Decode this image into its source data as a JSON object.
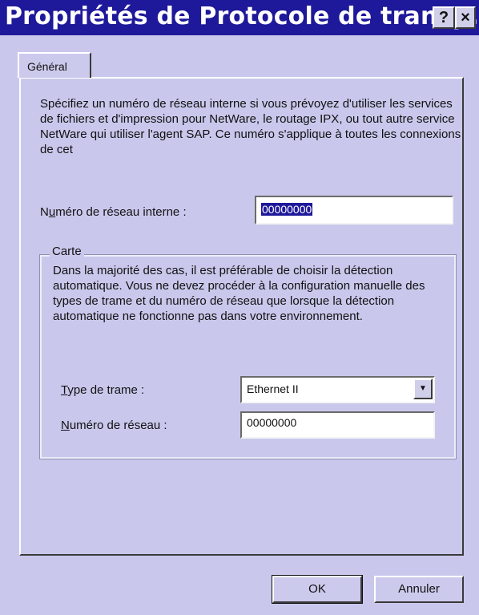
{
  "window": {
    "title": "Propriétés de Protocole de transp...",
    "help_button": "?",
    "close_button": "×"
  },
  "tabs": [
    {
      "label": "Général"
    }
  ],
  "main": {
    "description": "Spécifiez un numéro de réseau interne si vous prévoyez d'utiliser les services de fichiers et d'impression pour NetWare, le routage IPX, ou tout autre service NetWare qui utiliser l'agent SAP. Ce numéro s'applique à toutes les connexions de cet",
    "internal_network": {
      "label_pre": "N",
      "label_accel": "u",
      "label_post": "méro de réseau interne :",
      "value": "00000000"
    }
  },
  "carte": {
    "title": "Carte",
    "description": "Dans la majorité des cas, il est préférable de choisir la détection automatique. Vous ne devez procéder à la configuration manuelle des types de trame et du numéro de réseau que lorsque la détection automatique ne fonctionne pas dans votre environnement.",
    "frame_type": {
      "label_accel": "T",
      "label_post": "ype de trame :",
      "value": "Ethernet II"
    },
    "network_number": {
      "label_accel": "N",
      "label_post": "uméro de réseau :",
      "value": "00000000"
    }
  },
  "footer": {
    "ok_label": "OK",
    "cancel_label": "Annuler"
  }
}
